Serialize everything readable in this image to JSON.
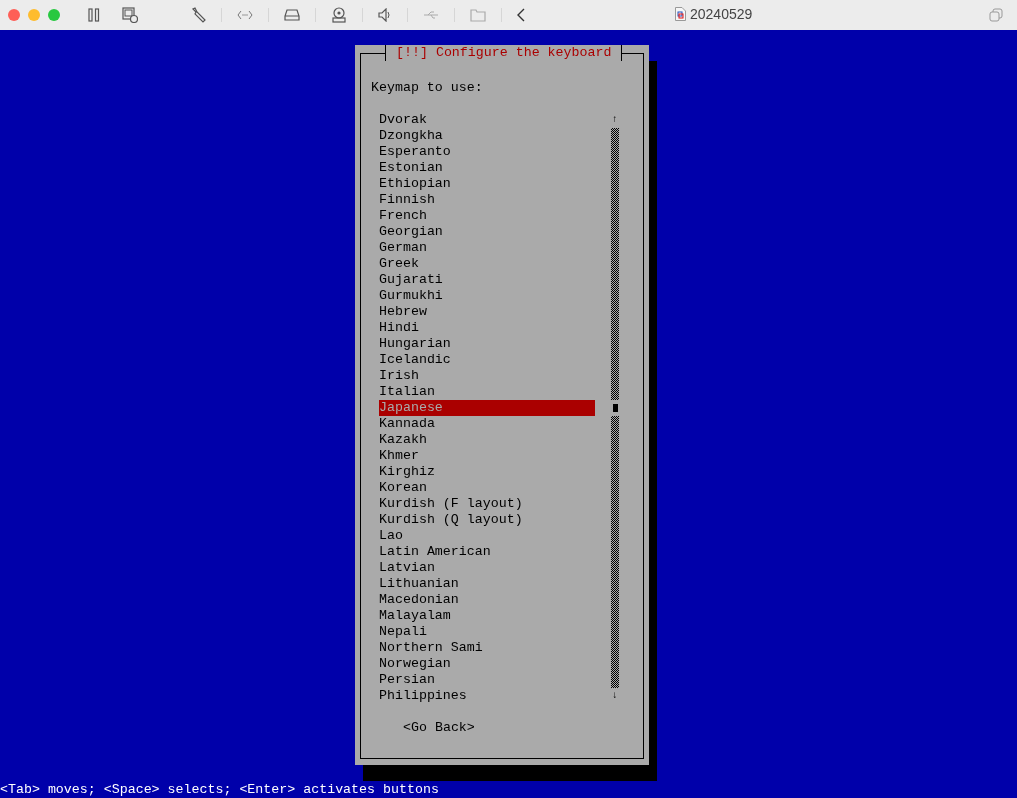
{
  "window": {
    "title": "20240529"
  },
  "dialog": {
    "title": "[!!] Configure the keyboard",
    "prompt": "Keymap to use:",
    "items": [
      {
        "label": "Dvorak",
        "selected": false
      },
      {
        "label": "Dzongkha",
        "selected": false
      },
      {
        "label": "Esperanto",
        "selected": false
      },
      {
        "label": "Estonian",
        "selected": false
      },
      {
        "label": "Ethiopian",
        "selected": false
      },
      {
        "label": "Finnish",
        "selected": false
      },
      {
        "label": "French",
        "selected": false
      },
      {
        "label": "Georgian",
        "selected": false
      },
      {
        "label": "German",
        "selected": false
      },
      {
        "label": "Greek",
        "selected": false
      },
      {
        "label": "Gujarati",
        "selected": false
      },
      {
        "label": "Gurmukhi",
        "selected": false
      },
      {
        "label": "Hebrew",
        "selected": false
      },
      {
        "label": "Hindi",
        "selected": false
      },
      {
        "label": "Hungarian",
        "selected": false
      },
      {
        "label": "Icelandic",
        "selected": false
      },
      {
        "label": "Irish",
        "selected": false
      },
      {
        "label": "Italian",
        "selected": false
      },
      {
        "label": "Japanese",
        "selected": true
      },
      {
        "label": "Kannada",
        "selected": false
      },
      {
        "label": "Kazakh",
        "selected": false
      },
      {
        "label": "Khmer",
        "selected": false
      },
      {
        "label": "Kirghiz",
        "selected": false
      },
      {
        "label": "Korean",
        "selected": false
      },
      {
        "label": "Kurdish (F layout)",
        "selected": false
      },
      {
        "label": "Kurdish (Q layout)",
        "selected": false
      },
      {
        "label": "Lao",
        "selected": false
      },
      {
        "label": "Latin American",
        "selected": false
      },
      {
        "label": "Latvian",
        "selected": false
      },
      {
        "label": "Lithuanian",
        "selected": false
      },
      {
        "label": "Macedonian",
        "selected": false
      },
      {
        "label": "Malayalam",
        "selected": false
      },
      {
        "label": "Nepali",
        "selected": false
      },
      {
        "label": "Northern Sami",
        "selected": false
      },
      {
        "label": "Norwegian",
        "selected": false
      },
      {
        "label": "Persian",
        "selected": false
      },
      {
        "label": "Philippines",
        "selected": false
      }
    ],
    "scroll_up": "↑",
    "scroll_down": "↓",
    "button": "<Go Back>"
  },
  "status_line": "<Tab> moves; <Space> selects; <Enter> activates buttons"
}
